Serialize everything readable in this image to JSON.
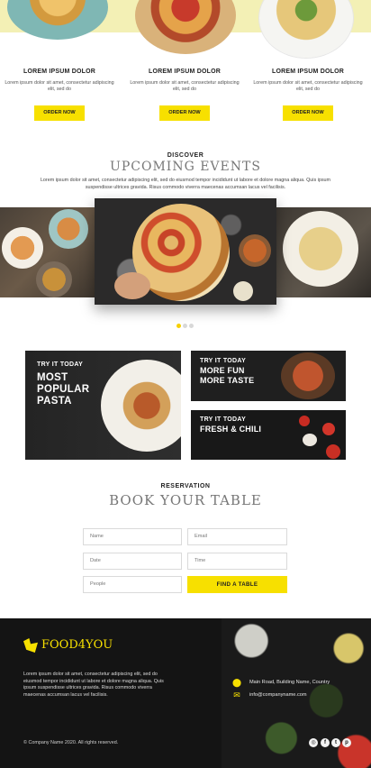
{
  "products": [
    {
      "title": "LOREM IPSUM DOLOR",
      "desc": "Lorem ipsum dolor sit amet, consectetur adipiscing elit, sed do",
      "button": "ORDER NOW"
    },
    {
      "title": "LOREM IPSUM DOLOR",
      "desc": "Lorem ipsum dolor sit amet, consectetur adipiscing elit, sed do",
      "button": "ORDER NOW"
    },
    {
      "title": "LOREM IPSUM DOLOR",
      "desc": "Lorem ipsum dolor sit amet, consectetur adipiscing elit, sed do",
      "button": "ORDER NOW"
    }
  ],
  "events": {
    "kicker": "DISCOVER",
    "title": "UPCOMING EVENTS",
    "desc": "Lorem ipsum dolor sit amet, consectetur adipiscing elit, sed do eiusmod tempor incididunt ut labore et dolore magna aliqua. Quis ipsum suspendisse ultrices gravida. Risus commodo viverra maecenas accumsan lacus vel facilisis.",
    "slider_dots": 3,
    "active_dot": 0
  },
  "promos": [
    {
      "kicker": "TRY IT TODAY",
      "lines": [
        "MOST",
        "POPULAR",
        "PASTA"
      ]
    },
    {
      "kicker": "TRY IT TODAY",
      "lines": [
        "MORE FUN",
        "MORE TASTE"
      ]
    },
    {
      "kicker": "TRY IT TODAY",
      "lines": [
        "FRESH & CHILI"
      ]
    }
  ],
  "reservation": {
    "kicker": "RESERVATION",
    "title": "BOOK YOUR TABLE",
    "fields": {
      "name": "Name",
      "email": "Email",
      "date": "Date",
      "time": "Time",
      "people": "People"
    },
    "button": "FIND A TABLE"
  },
  "footer": {
    "brand": "FOOD4YOU",
    "desc": "Lorem ipsum dolor sit amet, consectetur adipiscing elit, sed do eiusmod tempor incididunt ut labore et dolore magna aliqua. Quis ipsum suspendisse ultrices gravida. Risus commodo viverra maecenas accumsan lacus vel facilisis.",
    "address": "Main Road, Building Name, Country",
    "email": "info@companyname.com",
    "copyright": "© Company Name 2020. All rights reserved.",
    "social_icons": [
      "instagram-icon",
      "facebook-icon",
      "twitter-icon",
      "pinterest-icon"
    ]
  },
  "colors": {
    "accent": "#f7e000",
    "footer_bg": "#141414"
  }
}
